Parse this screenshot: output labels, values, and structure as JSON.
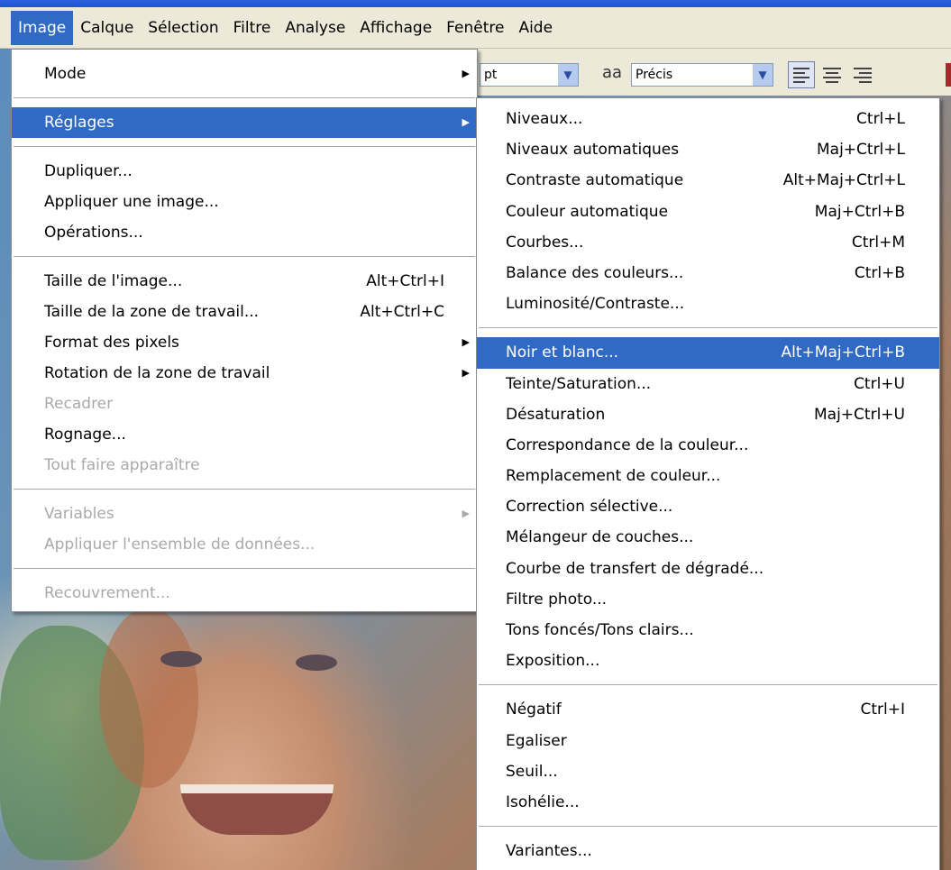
{
  "menubar": {
    "items": [
      "Image",
      "Calque",
      "Sélection",
      "Filtre",
      "Analyse",
      "Affichage",
      "Fenêtre",
      "Aide"
    ],
    "active": "Image"
  },
  "options_bar": {
    "font_size_unit": "pt",
    "antialias_icon": "aa-icon",
    "antialias_label": "aa",
    "antialias_value": "Précis"
  },
  "image_menu": {
    "mode": "Mode",
    "reglages": "Réglages",
    "dupliquer": "Dupliquer...",
    "appliquer_image": "Appliquer une image...",
    "operations": "Opérations...",
    "taille_image": "Taille de l'image...",
    "taille_image_sc": "Alt+Ctrl+I",
    "taille_zone": "Taille de la zone de travail...",
    "taille_zone_sc": "Alt+Ctrl+C",
    "format_pixels": "Format des pixels",
    "rotation": "Rotation de la zone de travail",
    "recadrer": "Recadrer",
    "rognage": "Rognage...",
    "tout_faire": "Tout faire apparaître",
    "variables": "Variables",
    "appliquer_ensemble": "Appliquer l'ensemble de données...",
    "recouvrement": "Recouvrement..."
  },
  "reglages_menu": {
    "niveaux": "Niveaux...",
    "niveaux_sc": "Ctrl+L",
    "niveaux_auto": "Niveaux automatiques",
    "niveaux_auto_sc": "Maj+Ctrl+L",
    "contraste_auto": "Contraste automatique",
    "contraste_auto_sc": "Alt+Maj+Ctrl+L",
    "couleur_auto": "Couleur automatique",
    "couleur_auto_sc": "Maj+Ctrl+B",
    "courbes": "Courbes...",
    "courbes_sc": "Ctrl+M",
    "balance": "Balance des couleurs...",
    "balance_sc": "Ctrl+B",
    "luminosite": "Luminosité/Contraste...",
    "noir_blanc": "Noir et blanc...",
    "noir_blanc_sc": "Alt+Maj+Ctrl+B",
    "teinte": "Teinte/Saturation...",
    "teinte_sc": "Ctrl+U",
    "desaturation": "Désaturation",
    "desaturation_sc": "Maj+Ctrl+U",
    "correspondance": "Correspondance de la couleur...",
    "remplacement": "Remplacement de couleur...",
    "correction": "Correction sélective...",
    "melangeur": "Mélangeur de couches...",
    "courbe_transfert": "Courbe de transfert de dégradé...",
    "filtre_photo": "Filtre photo...",
    "tons": "Tons foncés/Tons clairs...",
    "exposition": "Exposition...",
    "negatif": "Négatif",
    "negatif_sc": "Ctrl+I",
    "egaliser": "Egaliser",
    "seuil": "Seuil...",
    "isohelie": "Isohélie...",
    "variantes": "Variantes..."
  },
  "colors": {
    "highlight": "#316ac5",
    "menubar_bg": "#ece9d8",
    "disabled_text": "#a9a9a9"
  }
}
